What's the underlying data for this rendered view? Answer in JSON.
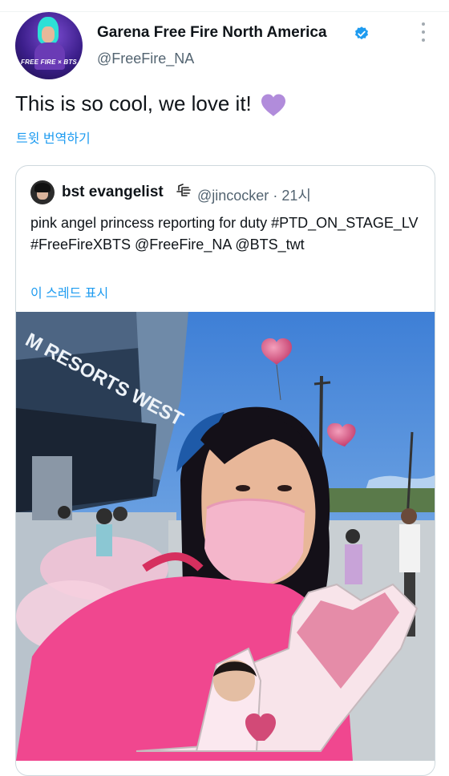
{
  "tweet": {
    "author_name": "Garena Free Fire North America",
    "author_handle": "@FreeFire_NA",
    "avatar_logo_text": "FREE FIRE × BTS",
    "text": "This is so cool, we love it!",
    "emoji": "purple-heart",
    "translate_label": "트윗 번역하기",
    "verified": true
  },
  "quoted": {
    "author_name": "bst evangelist",
    "author_handle": "@jincocker",
    "separator": "·",
    "time": "21시",
    "text": "pink angel princess reporting for duty #PTD_ON_STAGE_LV #FreeFireXBTS @FreeFire_NA @BTS_twt",
    "show_thread_label": "이 스레드 표시"
  },
  "photo": {
    "sign_text": "M RESORTS WEST"
  },
  "colors": {
    "link": "#1d9bf0",
    "verified": "#1d9bf0",
    "heart": "#b18cdb",
    "outfit": "#f0478f"
  }
}
